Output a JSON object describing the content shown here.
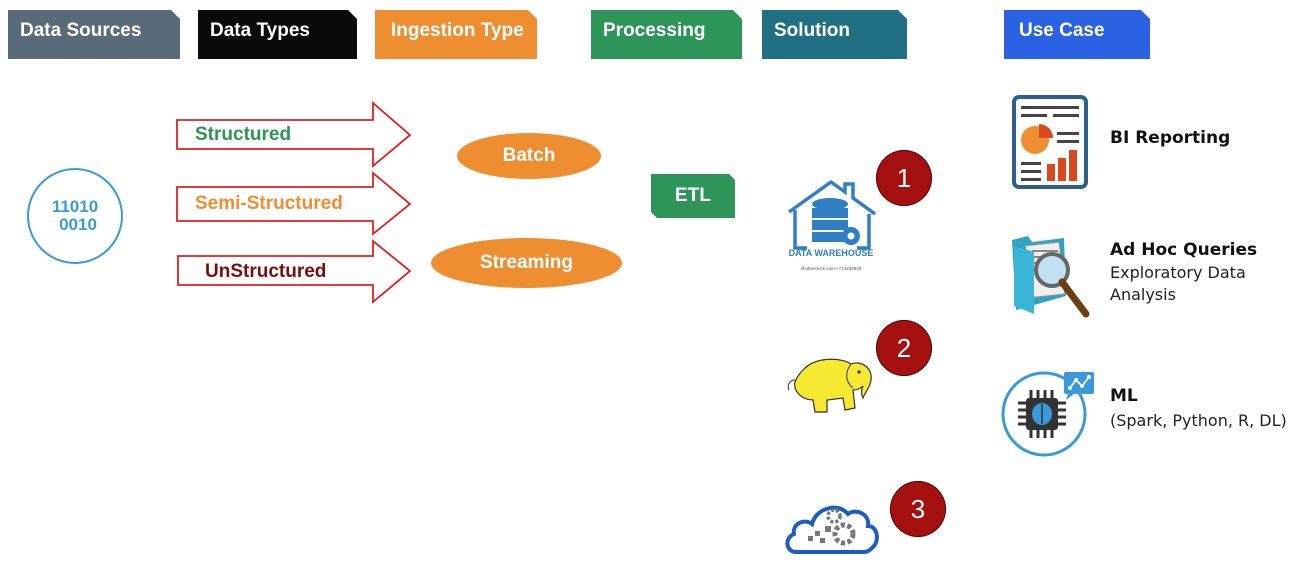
{
  "header": {
    "tabs": [
      {
        "label": "Data Sources",
        "color": "#596b78"
      },
      {
        "label": "Data Types",
        "color": "#0a0a0a"
      },
      {
        "label": "Ingestion Type",
        "color": "#ef8d31"
      },
      {
        "label": "Processing",
        "color": "#2e9558"
      },
      {
        "label": "Solution",
        "color": "#216f82"
      },
      {
        "label": "Use Case",
        "color": "#2b62e3"
      }
    ]
  },
  "data_source": {
    "icon": "binary-circle-icon",
    "line1": "11010",
    "line2": "0010",
    "color": "#3a9ad9"
  },
  "data_types": [
    {
      "label": "Structured",
      "color": "#2e9558"
    },
    {
      "label": "Semi-Structured",
      "color": "#ef8d31"
    },
    {
      "label": "UnStructured",
      "color": "#7a0e0e"
    }
  ],
  "arrow_outline_color": "#e02020",
  "ingestion": [
    {
      "label": "Batch"
    },
    {
      "label": "Streaming"
    }
  ],
  "processing": {
    "label": "ETL"
  },
  "solutions": [
    {
      "badge": "1",
      "icon": "data-warehouse-icon",
      "caption": "DATA WAREHOUSE",
      "credit": "shutterstock.com • 713230949"
    },
    {
      "badge": "2",
      "icon": "hadoop-elephant-icon"
    },
    {
      "badge": "3",
      "icon": "cloud-gears-icon"
    }
  ],
  "use_cases": [
    {
      "title": "BI Reporting",
      "subtitle": "",
      "icon": "report-icon"
    },
    {
      "title": "Ad Hoc Queries",
      "subtitle": "Exploratory Data Analysis",
      "icon": "folder-search-icon"
    },
    {
      "title": "ML",
      "subtitle": "(Spark, Python, R, DL)",
      "icon": "ai-chip-icon"
    }
  ]
}
